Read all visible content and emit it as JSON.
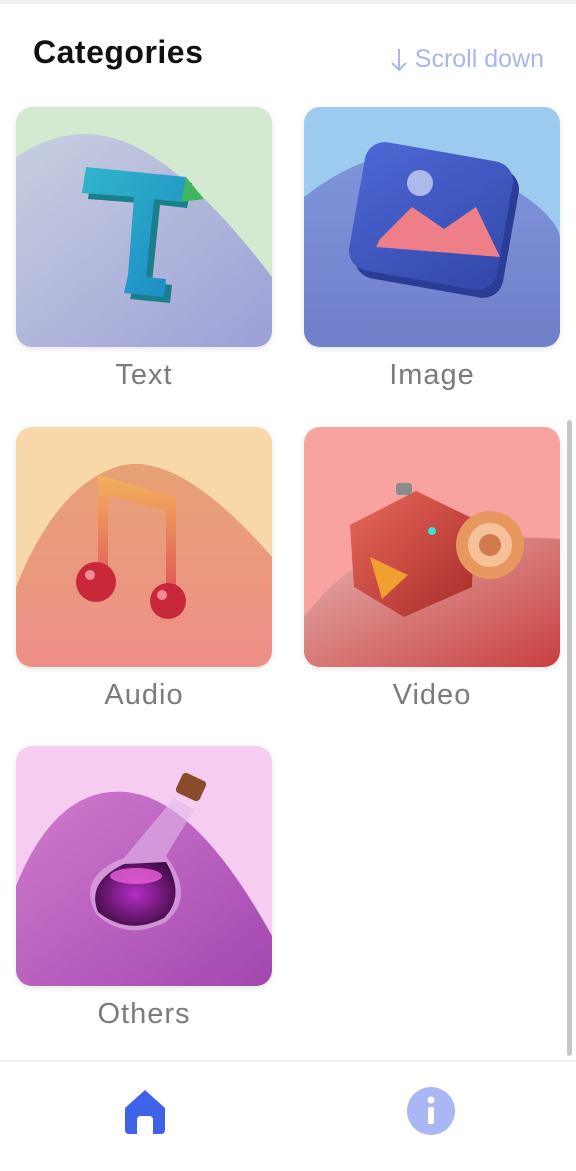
{
  "header": {
    "title": "Categories",
    "scroll_hint": "Scroll down"
  },
  "categories": [
    {
      "label": "Text",
      "icon": "letter-t-3d-icon"
    },
    {
      "label": "Image",
      "icon": "image-photo-3d-icon"
    },
    {
      "label": "Audio",
      "icon": "music-note-3d-icon"
    },
    {
      "label": "Video",
      "icon": "video-camera-3d-icon"
    },
    {
      "label": "Others",
      "icon": "potion-flask-3d-icon"
    }
  ],
  "bottom_nav": {
    "items": [
      {
        "icon": "home-icon",
        "active": true,
        "color": "#3f63e6"
      },
      {
        "icon": "info-icon",
        "active": false,
        "color": "#a9b7f4"
      }
    ]
  },
  "colors": {
    "accent": "#3f63e6",
    "accent_muted": "#a9b7f4",
    "scroll_hint": "#aab6ea"
  }
}
